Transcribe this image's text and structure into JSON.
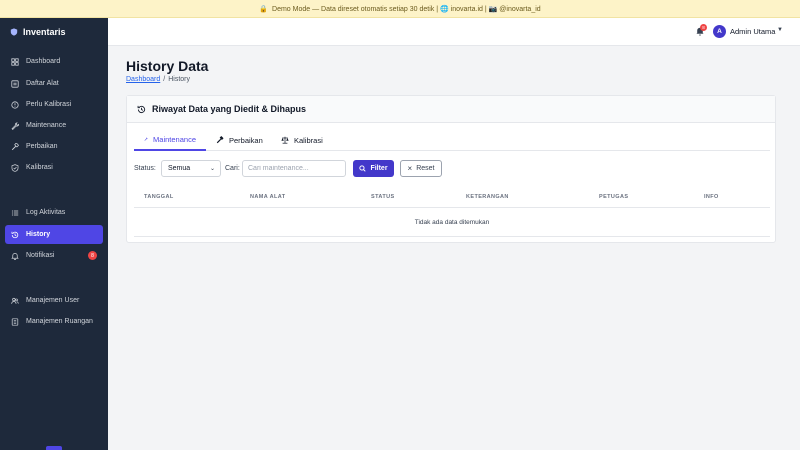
{
  "banner": {
    "text": "Demo Mode — Data direset otomatis setiap 30 detik | 🌐 inovarta.id | 📷 @inovarta_id"
  },
  "sidebar": {
    "brand": "Inventaris",
    "items": [
      {
        "label": "Dashboard",
        "icon": "grid-icon"
      },
      {
        "label": "Daftar Alat",
        "icon": "list-icon"
      },
      {
        "label": "Perlu Kalibrasi",
        "icon": "alert-circle-icon"
      },
      {
        "label": "Maintenance",
        "icon": "wrench-icon"
      },
      {
        "label": "Perbaikan",
        "icon": "hammer-icon"
      },
      {
        "label": "Kalibrasi",
        "icon": "shield-check-icon"
      },
      {
        "label": "Log Aktivitas",
        "icon": "log-list-icon"
      },
      {
        "label": "History",
        "icon": "history-icon",
        "active": true
      },
      {
        "label": "Notifikasi",
        "icon": "bell-icon",
        "badge": "8"
      },
      {
        "label": "Manajemen User",
        "icon": "users-icon"
      },
      {
        "label": "Manajemen Ruangan",
        "icon": "building-icon"
      }
    ]
  },
  "topbar": {
    "notif_count": "8",
    "avatar_letter": "A",
    "user_name": "Admin Utama"
  },
  "page": {
    "title": "History Data",
    "breadcrumb_link": "Dashboard",
    "breadcrumb_sep": "/",
    "breadcrumb_current": "History"
  },
  "card": {
    "title": "Riwayat Data yang Diedit & Dihapus",
    "tabs": [
      "Maintenance",
      "Perbaikan",
      "Kalibrasi"
    ],
    "active_tab": "Maintenance"
  },
  "filters": {
    "status_label": "Status:",
    "status_value": "Semua",
    "search_label": "Cari:",
    "search_placeholder": "Cari maintenance...",
    "filter_button": "Filter",
    "reset_button": "Reset"
  },
  "table": {
    "columns": [
      "TANGGAL",
      "NAMA ALAT",
      "STATUS",
      "KETERANGAN",
      "PETUGAS",
      "INFO"
    ],
    "empty_message": "Tidak ada data ditemukan"
  },
  "colors": {
    "accent": "#4f46e5",
    "sidebar_bg": "#1e293b",
    "banner_bg": "#fdf3c8",
    "badge": "#ef4444"
  }
}
